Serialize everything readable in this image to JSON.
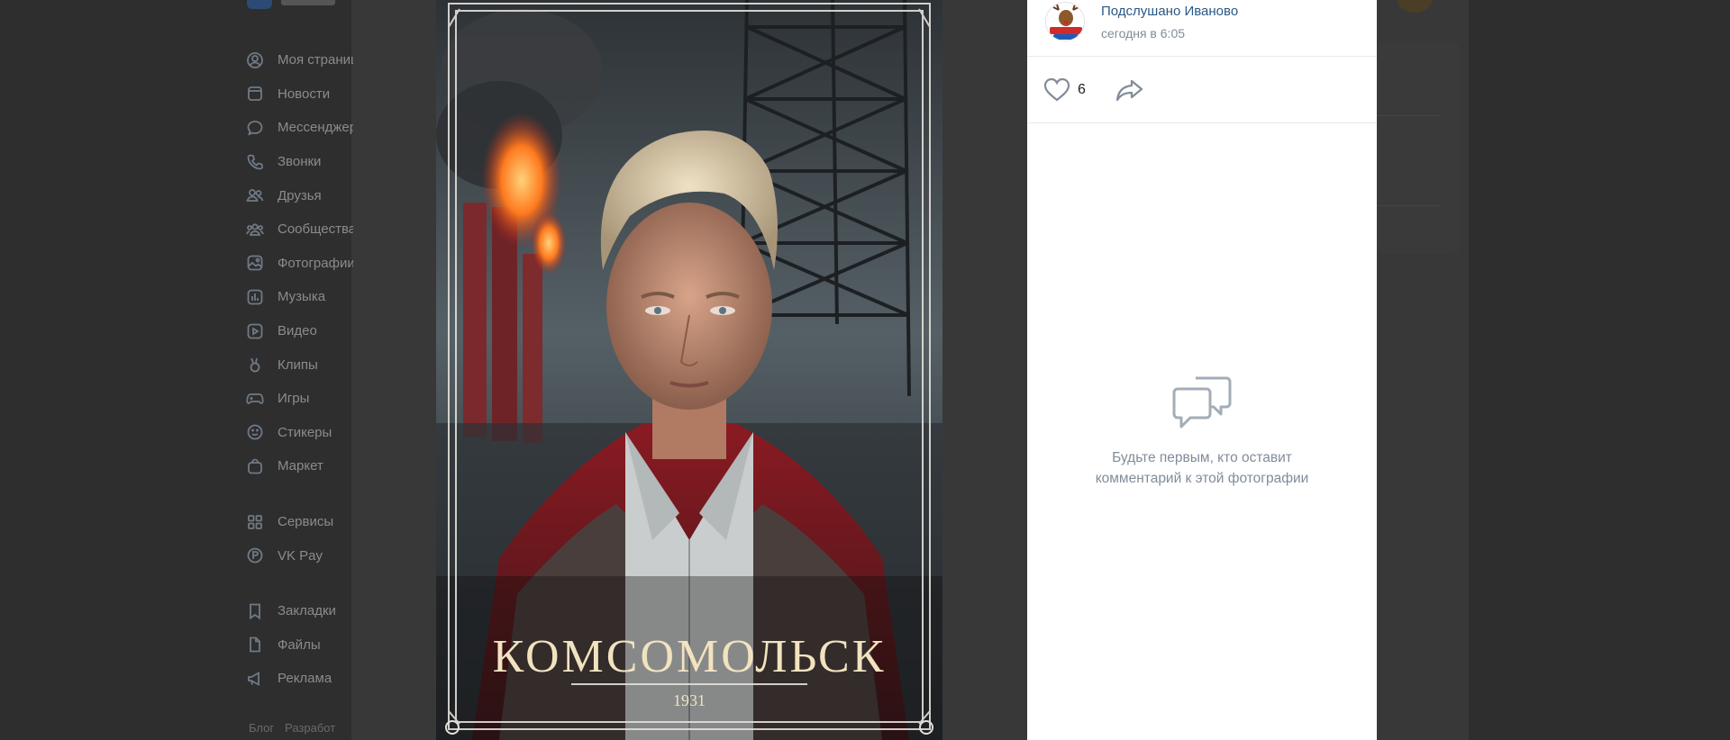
{
  "sidebar": {
    "items": [
      {
        "label": "Моя страница",
        "icon": "user-circle-icon"
      },
      {
        "label": "Новости",
        "icon": "newspaper-icon"
      },
      {
        "label": "Мессенджер",
        "icon": "chat-bubble-icon"
      },
      {
        "label": "Звонки",
        "icon": "phone-icon"
      },
      {
        "label": "Друзья",
        "icon": "friends-icon"
      },
      {
        "label": "Сообщества",
        "icon": "communities-icon"
      },
      {
        "label": "Фотографии",
        "icon": "photo-icon"
      },
      {
        "label": "Музыка",
        "icon": "music-icon"
      },
      {
        "label": "Видео",
        "icon": "video-icon"
      },
      {
        "label": "Клипы",
        "icon": "clips-icon"
      },
      {
        "label": "Игры",
        "icon": "gamepad-icon"
      },
      {
        "label": "Стикеры",
        "icon": "sticker-icon"
      },
      {
        "label": "Маркет",
        "icon": "shopping-bag-icon"
      }
    ],
    "items2": [
      {
        "label": "Сервисы",
        "icon": "grid-icon"
      },
      {
        "label": "VK Pay",
        "icon": "vkpay-icon"
      }
    ],
    "items3": [
      {
        "label": "Закладки",
        "icon": "bookmark-icon"
      },
      {
        "label": "Файлы",
        "icon": "file-icon"
      },
      {
        "label": "Реклама",
        "icon": "megaphone-icon"
      }
    ],
    "footer": [
      "Блог",
      "Разработ"
    ]
  },
  "photo": {
    "title": "КОМСОМОЛЬСК",
    "year": "1931"
  },
  "post": {
    "author": "Подслушано Иваново",
    "time": "сегодня в 6:05",
    "likes": "6",
    "empty_line1": "Будьте первым, кто оставит",
    "empty_line2": "комментарий к этой фотографии"
  },
  "colors": {
    "link": "#2a5885",
    "muted": "#818c99",
    "poster_text": "#f2e3c0"
  }
}
